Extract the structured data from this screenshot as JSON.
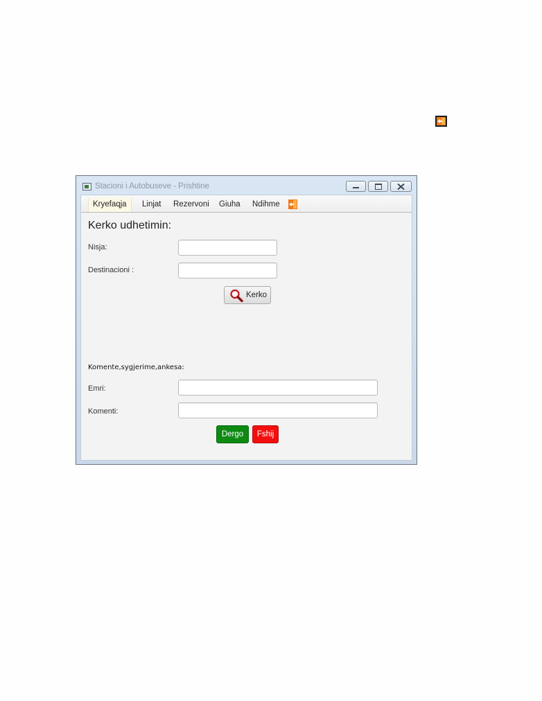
{
  "window": {
    "title": "Stacioni i Autobuseve - Prishtine",
    "controls": {
      "minimize": "minimize",
      "maximize": "maximize",
      "close": "close"
    }
  },
  "menu": {
    "items": [
      "Kryefaqja",
      "Linjat",
      "Rezervoni",
      "Giuha",
      "Ndihme"
    ],
    "selected": "Kryefaqja",
    "exit_icon": "exit-icon"
  },
  "search": {
    "heading": "Kerko udhetimin:",
    "nisja_label": "Nisja:",
    "nisja_value": "",
    "destinacioni_label": "Destinacioni :",
    "destinacioni_value": "",
    "button_label": "Kerko",
    "button_icon": "magnifier-icon"
  },
  "feedback": {
    "title": "Komente,sygjerime,ankesa:",
    "emri_label": "Emri:",
    "emri_value": "",
    "komenti_label": "Komenti:",
    "komenti_value": "",
    "send_label": "Dergo",
    "clear_label": "Fshij"
  },
  "colors": {
    "send_button": "#0e8a13",
    "clear_button": "#f40f0f",
    "exit_icon": "#f07a1a",
    "search_icon": "#c2141b"
  }
}
